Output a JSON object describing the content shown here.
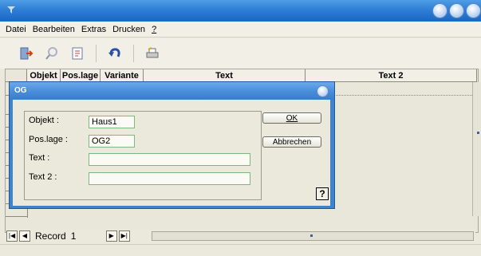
{
  "menu": {
    "items": [
      {
        "label": "Datei"
      },
      {
        "label": "Bearbeiten"
      },
      {
        "label": "Extras"
      },
      {
        "label": "Drucken"
      },
      {
        "label": "?"
      }
    ]
  },
  "toolbar": {
    "icons": [
      "exit-icon",
      "search-icon",
      "document-icon",
      "undo-icon",
      "printer-icon"
    ]
  },
  "grid": {
    "columns": [
      "Objekt",
      "Pos.lage",
      "Variante",
      "Text",
      "Text 2"
    ]
  },
  "nav": {
    "record_label": "Record",
    "record_number": "1"
  },
  "dialog": {
    "title": "OG",
    "labels": {
      "objekt": "Objekt :",
      "poslage": "Pos.lage :",
      "text": "Text :",
      "text2": "Text 2 :"
    },
    "values": {
      "objekt": "Haus1",
      "poslage": "OG2",
      "text": "",
      "text2": ""
    },
    "ok_label": "OK",
    "cancel_label": "Abbrechen",
    "help_label": "?"
  },
  "colors": {
    "title_bar": "#2e7fd6",
    "dialog_frame": "#3f83c8",
    "window_bg": "#ebe9dc"
  }
}
